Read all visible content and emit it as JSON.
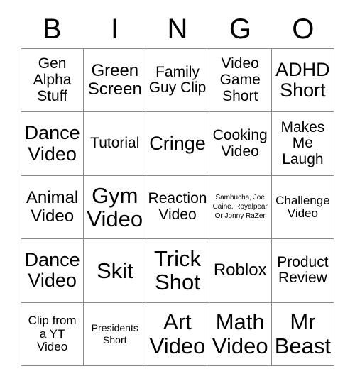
{
  "card": {
    "title_letters": [
      "B",
      "I",
      "N",
      "G",
      "O"
    ],
    "columns": 5,
    "rows": 5,
    "border_color": "#8a8a8a",
    "text_color": "#000000",
    "background_color": "#ffffff",
    "cells": [
      {
        "text": "Gen Alpha Stuff",
        "size": "md"
      },
      {
        "text": "Green Screen",
        "size": "lg"
      },
      {
        "text": "Family Guy Clip",
        "size": "md"
      },
      {
        "text": "Video Game Short",
        "size": "md"
      },
      {
        "text": "ADHD Short",
        "size": "xl"
      },
      {
        "text": "Dance Video",
        "size": "xl"
      },
      {
        "text": "Tutorial",
        "size": "md"
      },
      {
        "text": "Cringe",
        "size": "xl"
      },
      {
        "text": "Cooking Video",
        "size": "md"
      },
      {
        "text": "Makes Me Laugh",
        "size": "md"
      },
      {
        "text": "Animal Video",
        "size": "lg"
      },
      {
        "text": "Gym Video",
        "size": "xxl"
      },
      {
        "text": "Reaction Video",
        "size": "md"
      },
      {
        "text": "Sambucha, Joe Caine, Royalpear Or Jonny RaZer",
        "size": "xxs"
      },
      {
        "text": "Challenge Video",
        "size": "sm"
      },
      {
        "text": "Dance Video",
        "size": "xl"
      },
      {
        "text": "Skit",
        "size": "xxl"
      },
      {
        "text": "Trick Shot",
        "size": "xxl"
      },
      {
        "text": "Roblox",
        "size": "lg"
      },
      {
        "text": "Product Review",
        "size": "md"
      },
      {
        "text": "Clip from a YT Video",
        "size": "sm"
      },
      {
        "text": "Presidents Short",
        "size": "xs"
      },
      {
        "text": "Art Video",
        "size": "xxl"
      },
      {
        "text": "Math Video",
        "size": "xxl"
      },
      {
        "text": "Mr Beast",
        "size": "xxl"
      }
    ]
  }
}
